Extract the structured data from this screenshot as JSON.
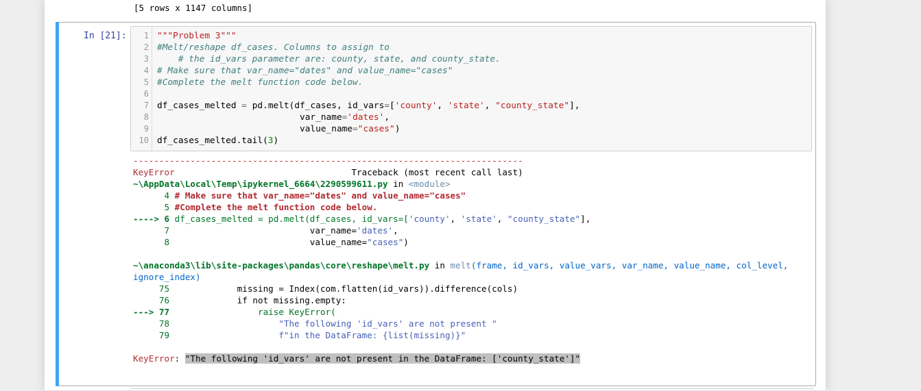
{
  "prev_output": "[5 rows x 1147 columns]",
  "cell": {
    "prompt": "In [21]:",
    "line_numbers": [
      "1",
      "2",
      "3",
      "4",
      "5",
      "6",
      "7",
      "8",
      "9",
      "10"
    ],
    "code": {
      "l1": "\"\"\"Problem 3\"\"\"",
      "l2": "#Melt/reshape df_cases. Columns to assign to",
      "l3": "    # the id_vars parameter are: county, state, and county_state.",
      "l4": "# Make sure that var_name=\"dates\" and value_name=\"cases\"",
      "l5": "#Complete the melt function code below.",
      "l7a": "df_cases_melted ",
      "l7b": "=",
      "l7c": " pd.melt(df_cases, id_vars",
      "l7d": "=",
      "l7e": "[",
      "l7f": "'county'",
      "l7g": ", ",
      "l7h": "'state'",
      "l7i": ", ",
      "l7j": "\"county_state\"",
      "l7k": "],",
      "l8a": "                           var_name",
      "l8b": "=",
      "l8c": "'dates'",
      "l8d": ",",
      "l9a": "                           value_name",
      "l9b": "=",
      "l9c": "\"cases\"",
      "l9d": ")",
      "l10a": "df_cases_melted.tail(",
      "l10b": "3",
      "l10c": ")"
    }
  },
  "traceback": {
    "dashes": "---------------------------------------------------------------------------",
    "err_name": "KeyError",
    "header_right": "                                  Traceback (most recent call last)",
    "file1": "~\\AppData\\Local\\Temp\\ipykernel_6664\\2290599611.py",
    "in_word": " in ",
    "module": "<module>",
    "f1_l4_num": "      4 ",
    "f1_l4_code": "# Make sure that var_name=\"dates\" and value_name=\"cases\"",
    "f1_l5_num": "      5 ",
    "f1_l5_code": "#Complete the melt function code below.",
    "f1_arrow": "----> 6 ",
    "f1_l6_a": "df_cases_melted = pd.melt(df_cases, id_vars=[",
    "f1_l6_b": "'county'",
    "f1_l6_c": ", ",
    "f1_l6_d": "'state'",
    "f1_l6_e": ", ",
    "f1_l6_f": "\"county_state\"",
    "f1_l6_g": "],",
    "f1_l7_num": "      7 ",
    "f1_l7_a": "                          var_name=",
    "f1_l7_b": "'dates'",
    "f1_l7_c": ",",
    "f1_l8_num": "      8 ",
    "f1_l8_a": "                          value_name=",
    "f1_l8_b": "\"cases\"",
    "f1_l8_c": ")",
    "file2": "~\\anaconda3\\lib\\site-packages\\pandas\\core\\reshape\\melt.py",
    "in_word2": " in ",
    "func": "melt",
    "sig": "(frame, id_vars, value_vars, var_name, value_name, col_level,",
    "sig2": "ignore_index)",
    "f2_75_num": "     75 ",
    "f2_75_code": "            missing = Index(com.flatten(id_vars)).difference(cols)",
    "f2_76_num": "     76 ",
    "f2_76_code": "            if not missing.empty:",
    "f2_arrow": "---> 77 ",
    "f2_77_code": "                raise KeyError(",
    "f2_78_num": "     78 ",
    "f2_78_code": "                    \"The following 'id_vars' are not present \"",
    "f2_79_num": "     79 ",
    "f2_79_code": "                    f\"in the DataFrame: {list(missing)}\"",
    "final_name": "KeyError",
    "final_colon": ": ",
    "final_msg": "\"The following 'id_vars' are not present in the DataFrame: ['county_state']\""
  }
}
